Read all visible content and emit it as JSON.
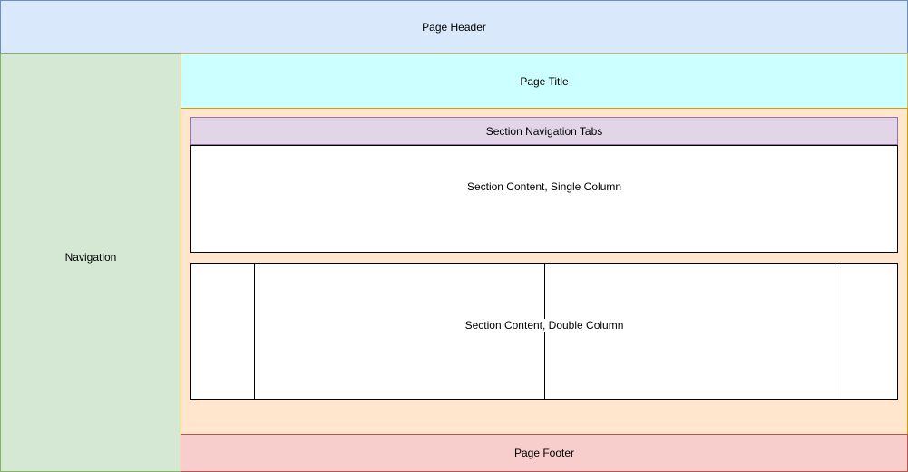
{
  "header": {
    "label": "Page Header"
  },
  "navigation": {
    "label": "Navigation"
  },
  "page_title": {
    "label": "Page Title"
  },
  "content": {
    "tabs": {
      "label": "Section Navigation Tabs"
    },
    "single_column": {
      "label": "Section Content, Single Column"
    },
    "double_column": {
      "label": "Section Content, Double Column"
    }
  },
  "footer": {
    "label": "Page Footer"
  },
  "colors": {
    "header_fill": "#dae8fc",
    "header_stroke": "#6c8ebf",
    "navigation_fill": "#d5e8d4",
    "navigation_stroke": "#82b366",
    "page_title_fill": "#ccffff",
    "page_title_stroke": "#d6b656",
    "content_fill": "#ffe6cc",
    "content_stroke": "#d79b00",
    "tabs_fill": "#e1d5e7",
    "tabs_stroke": "#9673a6",
    "footer_fill": "#f8cecc",
    "footer_stroke": "#b85450",
    "box_fill": "#ffffff",
    "box_stroke": "#000000",
    "text": "#000000"
  }
}
